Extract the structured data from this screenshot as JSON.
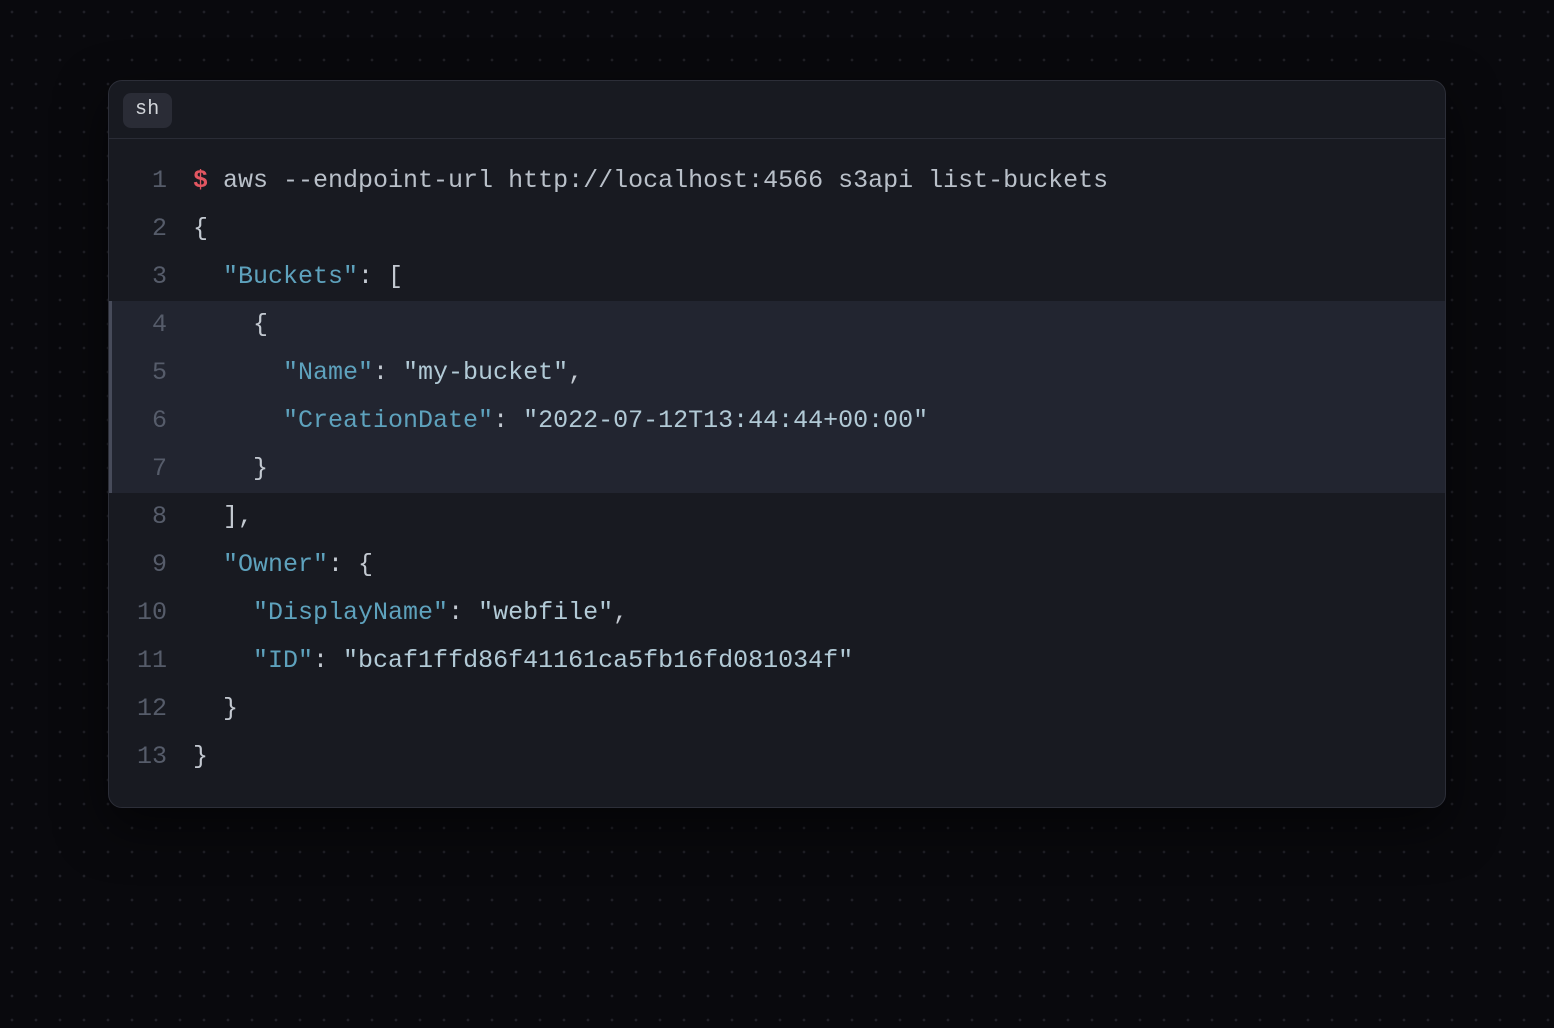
{
  "tab_label": "sh",
  "lines": [
    {
      "n": 1,
      "hl": false,
      "tokens": [
        {
          "cls": "t-prompt",
          "t": "$"
        },
        {
          "cls": "t-cmd",
          "t": " aws --endpoint-url http://localhost:4566 s3api list-buckets"
        }
      ]
    },
    {
      "n": 2,
      "hl": false,
      "tokens": [
        {
          "cls": "t-punct",
          "t": "{"
        }
      ]
    },
    {
      "n": 3,
      "hl": false,
      "tokens": [
        {
          "cls": "t-punct",
          "t": "  "
        },
        {
          "cls": "t-key",
          "t": "\"Buckets\""
        },
        {
          "cls": "t-punct",
          "t": ": ["
        }
      ]
    },
    {
      "n": 4,
      "hl": true,
      "tokens": [
        {
          "cls": "t-punct",
          "t": "    {"
        }
      ]
    },
    {
      "n": 5,
      "hl": true,
      "tokens": [
        {
          "cls": "t-punct",
          "t": "      "
        },
        {
          "cls": "t-key",
          "t": "\"Name\""
        },
        {
          "cls": "t-punct",
          "t": ": "
        },
        {
          "cls": "t-str",
          "t": "\"my-bucket\""
        },
        {
          "cls": "t-punct",
          "t": ","
        }
      ]
    },
    {
      "n": 6,
      "hl": true,
      "tokens": [
        {
          "cls": "t-punct",
          "t": "      "
        },
        {
          "cls": "t-key",
          "t": "\"CreationDate\""
        },
        {
          "cls": "t-punct",
          "t": ": "
        },
        {
          "cls": "t-str",
          "t": "\"2022-07-12T13:44:44+00:00\""
        }
      ]
    },
    {
      "n": 7,
      "hl": true,
      "tokens": [
        {
          "cls": "t-punct",
          "t": "    }"
        }
      ]
    },
    {
      "n": 8,
      "hl": false,
      "tokens": [
        {
          "cls": "t-punct",
          "t": "  ],"
        }
      ]
    },
    {
      "n": 9,
      "hl": false,
      "tokens": [
        {
          "cls": "t-punct",
          "t": "  "
        },
        {
          "cls": "t-key",
          "t": "\"Owner\""
        },
        {
          "cls": "t-punct",
          "t": ": {"
        }
      ]
    },
    {
      "n": 10,
      "hl": false,
      "tokens": [
        {
          "cls": "t-punct",
          "t": "    "
        },
        {
          "cls": "t-key",
          "t": "\"DisplayName\""
        },
        {
          "cls": "t-punct",
          "t": ": "
        },
        {
          "cls": "t-str",
          "t": "\"webfile\""
        },
        {
          "cls": "t-punct",
          "t": ","
        }
      ]
    },
    {
      "n": 11,
      "hl": false,
      "tokens": [
        {
          "cls": "t-punct",
          "t": "    "
        },
        {
          "cls": "t-key",
          "t": "\"ID\""
        },
        {
          "cls": "t-punct",
          "t": ": "
        },
        {
          "cls": "t-str",
          "t": "\"bcaf1ffd86f41161ca5fb16fd081034f\""
        }
      ]
    },
    {
      "n": 12,
      "hl": false,
      "tokens": [
        {
          "cls": "t-punct",
          "t": "  }"
        }
      ]
    },
    {
      "n": 13,
      "hl": false,
      "tokens": [
        {
          "cls": "t-punct",
          "t": "}"
        }
      ]
    }
  ]
}
